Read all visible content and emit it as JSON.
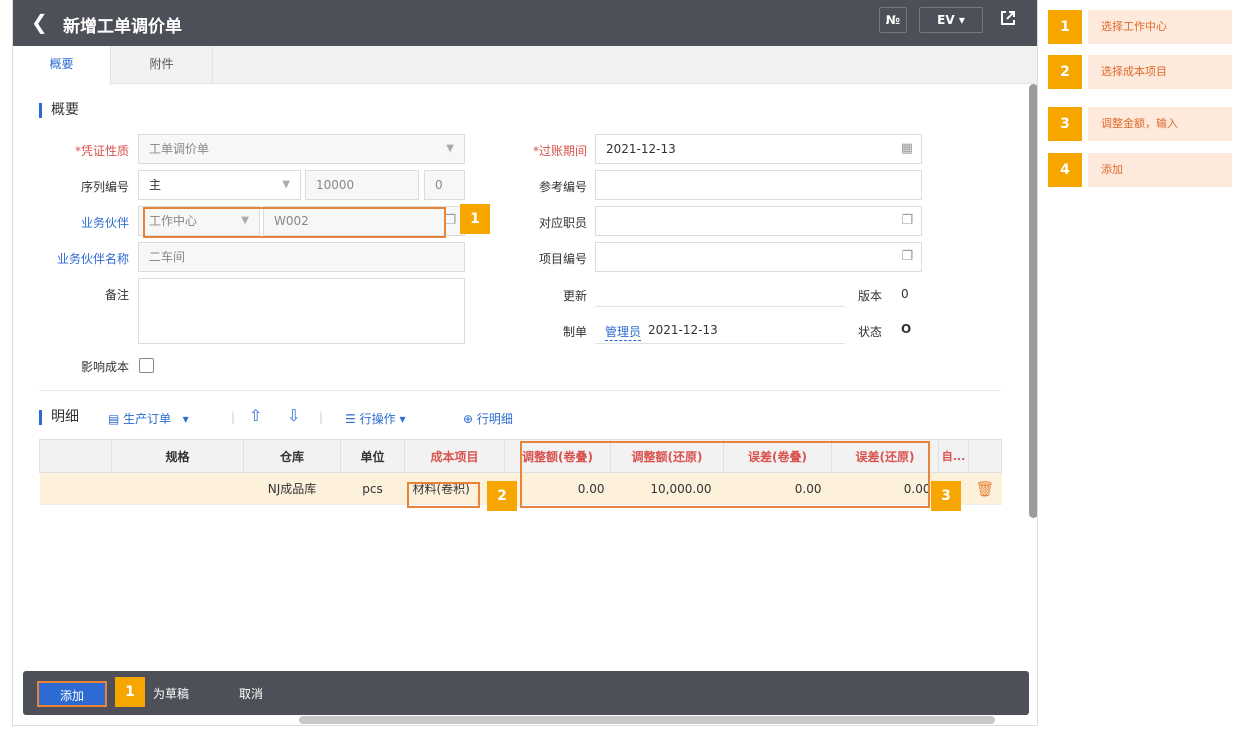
{
  "header": {
    "title": "新增工单调价单",
    "btn_no": "№",
    "btn_ev": "EV ▾",
    "colors": {
      "bar": "#4d5058",
      "accent": "#2d6bd2",
      "highlight": "#e8833a",
      "badge": "#f7a600"
    }
  },
  "tabs": [
    {
      "label": "概要"
    },
    {
      "label": "附件"
    }
  ],
  "summary": {
    "section_title": "概要",
    "voucher_type": {
      "label": "*凭证性质",
      "value": "工单调价单"
    },
    "serial_no": {
      "label": "序列编号",
      "value": "主",
      "number": "10000",
      "suffix": "0"
    },
    "partner": {
      "label": "业务伙伴",
      "type_value": "工作中心",
      "code_value": "W002"
    },
    "partner_name": {
      "label": "业务伙伴名称",
      "value": "二车间"
    },
    "remark": {
      "label": "备注",
      "value": ""
    },
    "affect_cost": {
      "label": "影响成本",
      "checked": false
    },
    "posting_period": {
      "label": "*过账期间",
      "value": "2021-12-13"
    },
    "ref_no": {
      "label": "参考编号",
      "value": ""
    },
    "staff": {
      "label": "对应职员",
      "value": ""
    },
    "project_no": {
      "label": "项目编号",
      "value": ""
    },
    "update": {
      "label": "更新",
      "value": ""
    },
    "version": {
      "label": "版本",
      "value": "0"
    },
    "maker": {
      "label": "制单",
      "user": "管理员",
      "date": "2021-12-13"
    },
    "status": {
      "label": "状态",
      "value": "O"
    }
  },
  "detail": {
    "section_title": "明细",
    "toolbar": {
      "production_order": "生产订单",
      "row_ops": "行操作",
      "row_detail": "行明细"
    },
    "columns": [
      "规格",
      "仓库",
      "单位",
      "成本项目",
      "调整额(卷叠)",
      "调整额(还原)",
      "误差(卷叠)",
      "误差(还原)",
      "自..."
    ],
    "rows": [
      {
        "spec": "",
        "warehouse": "NJ成品库",
        "unit": "pcs",
        "cost_item": "材料(卷积)",
        "adj_rollup": "0.00",
        "adj_restore": "10,000.00",
        "err_rollup": "0.00",
        "err_restore": "0.00"
      }
    ]
  },
  "footer": {
    "add": "添加",
    "save_draft": "为草稿",
    "cancel": "取消"
  },
  "badges": {
    "b1": "1",
    "b2": "2",
    "b3": "3",
    "b_footer": "1"
  },
  "legend": [
    {
      "num": "1",
      "text": "选择工作中心"
    },
    {
      "num": "2",
      "text": "选择成本项目"
    },
    {
      "num": "3",
      "text": "调整金额，输入"
    },
    {
      "num": "4",
      "text": "添加"
    }
  ]
}
